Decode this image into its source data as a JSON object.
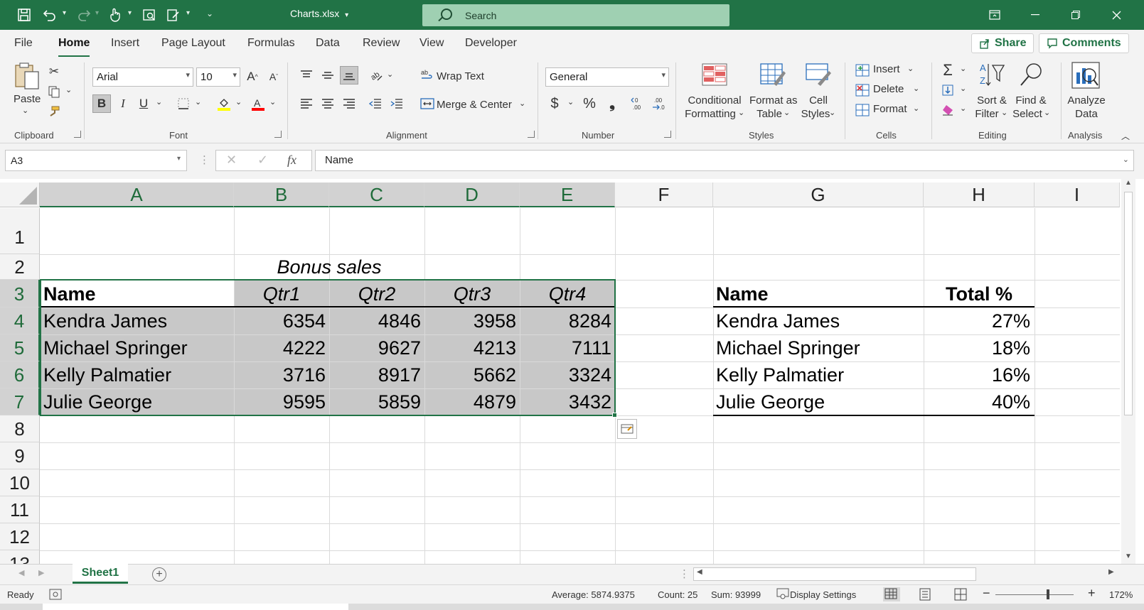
{
  "titlebar": {
    "filename": "Charts.xlsx",
    "search_placeholder": "Search",
    "accent": "#217346"
  },
  "ribbon_tabs": [
    "File",
    "Home",
    "Insert",
    "Page Layout",
    "Formulas",
    "Data",
    "Review",
    "View",
    "Developer"
  ],
  "ribbon_actions": {
    "share": "Share",
    "comments": "Comments"
  },
  "clipboard": {
    "paste": "Paste",
    "label": "Clipboard"
  },
  "font": {
    "name": "Arial",
    "size": "10",
    "label": "Font",
    "bold": "B",
    "italic": "I",
    "underline": "U",
    "highlight_color": "#ffff00",
    "font_color": "#ff0000"
  },
  "alignment": {
    "wrap_text": "Wrap Text",
    "merge_center": "Merge & Center",
    "label": "Alignment"
  },
  "number": {
    "format": "General",
    "label": "Number",
    "currency": "$",
    "percent": "%",
    "comma": "❟"
  },
  "styles": {
    "conditional_1": "Conditional",
    "conditional_2": "Formatting",
    "format_table_1": "Format as",
    "format_table_2": "Table",
    "cell_styles_1": "Cell",
    "cell_styles_2": "Styles",
    "label": "Styles"
  },
  "cells": {
    "insert": "Insert",
    "delete": "Delete",
    "format": "Format",
    "label": "Cells"
  },
  "editing": {
    "sort_1": "Sort &",
    "sort_2": "Filter",
    "find_1": "Find &",
    "find_2": "Select",
    "label": "Editing"
  },
  "analysis": {
    "analyze_1": "Analyze",
    "analyze_2": "Data",
    "label": "Analysis"
  },
  "formula_bar": {
    "name_box": "A3",
    "fx": "fx",
    "content": "Name"
  },
  "columns": [
    "A",
    "B",
    "C",
    "D",
    "E",
    "F",
    "G",
    "H",
    "I"
  ],
  "rows": [
    "1",
    "2",
    "3",
    "4",
    "5",
    "6",
    "7",
    "8",
    "9",
    "10",
    "11",
    "12",
    "13"
  ],
  "sheet": {
    "title": "Bonus sales",
    "headers": [
      "Name",
      "Qtr1",
      "Qtr2",
      "Qtr3",
      "Qtr4"
    ],
    "data": [
      [
        "Kendra James",
        "6354",
        "4846",
        "3958",
        "8284"
      ],
      [
        "Michael Springer",
        "4222",
        "9627",
        "4213",
        "7111"
      ],
      [
        "Kelly Palmatier",
        "3716",
        "8917",
        "5662",
        "3324"
      ],
      [
        "Julie George",
        "9595",
        "5859",
        "4879",
        "3432"
      ]
    ],
    "summary_headers": [
      "Name",
      "Total %"
    ],
    "summary": [
      [
        "Kendra James",
        "27%"
      ],
      [
        "Michael Springer",
        "18%"
      ],
      [
        "Kelly Palmatier",
        "16%"
      ],
      [
        "Julie George",
        "40%"
      ]
    ]
  },
  "sheet_tabs": [
    "Sheet1"
  ],
  "status": {
    "mode": "Ready",
    "average": "Average: 5874.9375",
    "count": "Count: 25",
    "sum": "Sum: 93999",
    "display_settings": "Display Settings",
    "zoom": "172%"
  }
}
